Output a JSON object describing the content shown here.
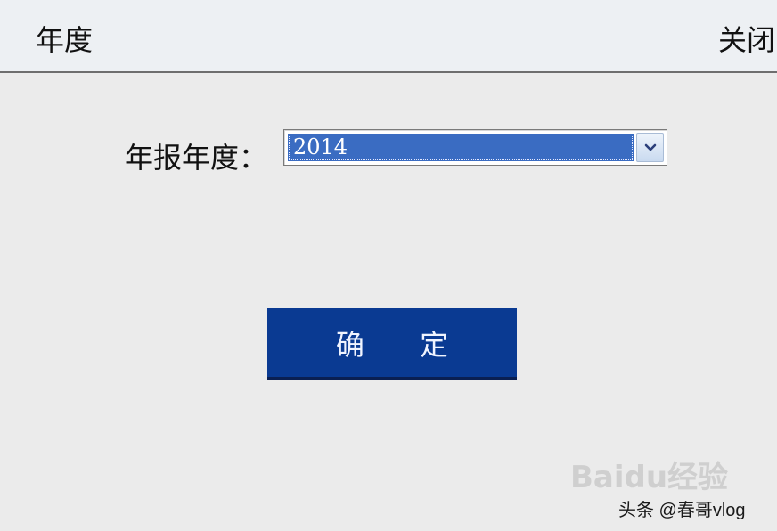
{
  "window": {
    "title": "年度",
    "close_label": "关闭"
  },
  "form": {
    "year_label": "年报年度：",
    "year_select": {
      "selected": "2014",
      "arrow_icon": "chevron-down-icon"
    },
    "confirm_label": "确 定"
  },
  "overlay": {
    "watermark_text": "Baidu经验",
    "credit": "头条 @春哥vlog"
  },
  "colors": {
    "button_bg": "#0a3a92",
    "select_highlight": "#3a6cc2",
    "titlebar_bg": "#edf0f3"
  }
}
